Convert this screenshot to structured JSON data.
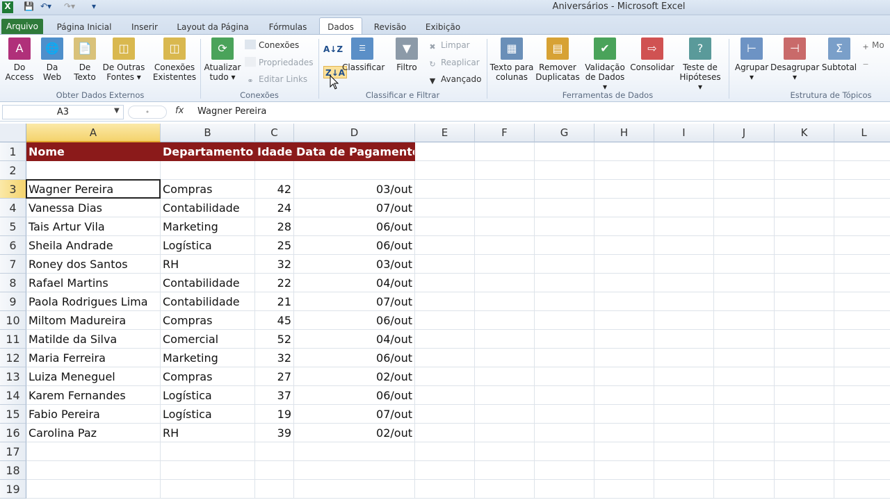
{
  "window": {
    "title": "Aniversários  -  Microsoft Excel"
  },
  "tabs": [
    "Arquivo",
    "Página Inicial",
    "Inserir",
    "Layout da Página",
    "Fórmulas",
    "Dados",
    "Revisão",
    "Exibição"
  ],
  "ribbon": {
    "obter": {
      "do_access": [
        "Do",
        "Access"
      ],
      "da_web": [
        "Da",
        "Web"
      ],
      "de_texto": [
        "De",
        "Texto"
      ],
      "outras": [
        "De Outras",
        "Fontes ▾"
      ],
      "conexoes_existentes": [
        "Conexões",
        "Existentes"
      ],
      "label": "Obter Dados Externos"
    },
    "conexoes": {
      "atualizar": [
        "Atualizar",
        "tudo ▾"
      ],
      "conexoes": "Conexões",
      "propriedades": "Propriedades",
      "editar_links": "Editar Links",
      "label": "Conexões"
    },
    "classificar": {
      "az_icon": "A↓Z",
      "za_icon": "Z↓A",
      "classificar": "Classificar",
      "filtro": "Filtro",
      "limpar": "Limpar",
      "reaplicar": "Reaplicar",
      "avancado": "Avançado",
      "label": "Classificar e Filtrar"
    },
    "ferramentas": {
      "texto_colunas": [
        "Texto para",
        "colunas"
      ],
      "remover": [
        "Remover",
        "Duplicatas"
      ],
      "validacao": [
        "Validação",
        "de Dados ▾"
      ],
      "consolidar": "Consolidar",
      "teste": [
        "Teste de",
        "Hipóteses ▾"
      ],
      "label": "Ferramentas de Dados"
    },
    "estrutura": {
      "agrupar": "Agrupar",
      "desagrupar": "Desagrupar",
      "subtotal": "Subtotal",
      "mo": "Mo",
      "label": "Estrutura de Tópicos"
    }
  },
  "formula_bar": {
    "name_box": "A3",
    "fx": "fx",
    "value": "Wagner Pereira"
  },
  "columns": [
    "A",
    "B",
    "C",
    "D",
    "E",
    "F",
    "G",
    "H",
    "I",
    "J",
    "K",
    "L"
  ],
  "rows": [
    "1",
    "2",
    "3",
    "4",
    "5",
    "6",
    "7",
    "8",
    "9",
    "10",
    "11",
    "12",
    "13",
    "14",
    "15",
    "16",
    "17",
    "18",
    "19"
  ],
  "header_row": [
    "Nome",
    "Departamento",
    "Idade",
    "Data de Pagamento"
  ],
  "data_rows": [
    [
      "Wagner Pereira",
      "Compras",
      "42",
      "03/out"
    ],
    [
      "Vanessa Dias",
      "Contabilidade",
      "24",
      "07/out"
    ],
    [
      "Tais Artur Vila",
      "Marketing",
      "28",
      "06/out"
    ],
    [
      "Sheila Andrade",
      "Logística",
      "25",
      "06/out"
    ],
    [
      "Roney dos Santos",
      "RH",
      "32",
      "03/out"
    ],
    [
      "Rafael Martins",
      "Contabilidade",
      "22",
      "04/out"
    ],
    [
      "Paola Rodrigues Lima",
      "Contabilidade",
      "21",
      "07/out"
    ],
    [
      "Miltom Madureira",
      "Compras",
      "45",
      "06/out"
    ],
    [
      "Matilde da Silva",
      "Comercial",
      "52",
      "04/out"
    ],
    [
      "Maria Ferreira",
      "Marketing",
      "32",
      "06/out"
    ],
    [
      "Luiza Meneguel",
      "Compras",
      "27",
      "02/out"
    ],
    [
      "Karem Fernandes",
      "Logística",
      "37",
      "06/out"
    ],
    [
      "Fabio Pereira",
      "Logística",
      "19",
      "07/out"
    ],
    [
      "Carolina Paz",
      "RH",
      "39",
      "02/out"
    ]
  ],
  "colors": {
    "header_fill": "#8b1a1a",
    "active_header": "#f4d36d",
    "file_tab": "#2f7a3a"
  }
}
